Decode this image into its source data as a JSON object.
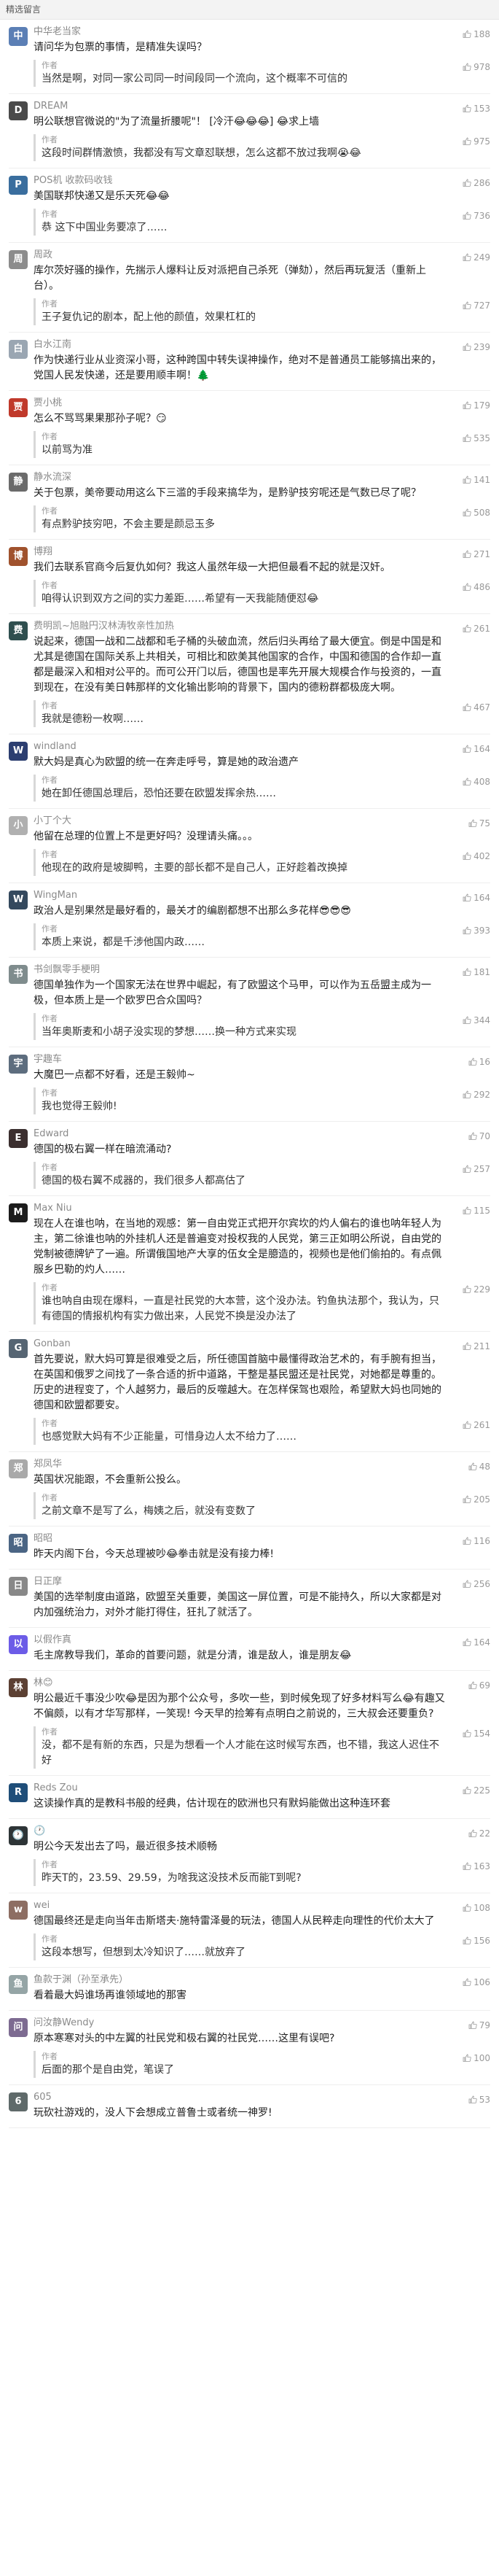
{
  "header": {
    "title": "精选留言"
  },
  "author_tag": "作者",
  "comments": [
    {
      "avatar_color": "#5b7fb5",
      "avatar_char": "中",
      "name": "中华老当家",
      "likes": "188",
      "text": "请问华为包票的事情，是精准失误吗？",
      "reply": "当然是啊，对同一家公司同一时间段同一个流向，这个概率不可信的",
      "reply_likes": "978"
    },
    {
      "avatar_color": "#4a4a4a",
      "avatar_char": "D",
      "name": "DREAM",
      "likes": "153",
      "text": "明公联想官微说的\"为了流量折腰呢\"！ [冷汗😂😂😂] 😂求上墙",
      "reply": "这段时间群情激愤，我都没有写文章怼联想，怎么这都不放过我啊😭😂",
      "reply_likes": "975"
    },
    {
      "avatar_color": "#3a6e9e",
      "avatar_char": "P",
      "name": "POS机 收款码收钱",
      "likes": "286",
      "text": "美国联邦快递又是乐天死😂😂",
      "reply": "恭 这下中国业务要凉了……",
      "reply_likes": "736"
    },
    {
      "avatar_color": "#8c8c8c",
      "avatar_char": "周",
      "name": "周政",
      "likes": "249",
      "text": "库尔茨好骚的操作，先揣示人爆料让反对派把自己杀死（弹劾），然后再玩复活（重新上台）。",
      "reply": "王子复仇记的剧本，配上他的颜值，效果杠杠的",
      "reply_likes": "727"
    },
    {
      "avatar_color": "#9aa6b2",
      "avatar_char": "白",
      "name": "白水江南",
      "likes": "239",
      "text": "作为快递行业从业资深小哥，这种跨国中转失误神操作，绝对不是普通员工能够搞出来的，党国人民发快递，还是要用顺丰啊！🌲",
      "reply": "",
      "reply_likes": ""
    },
    {
      "avatar_color": "#c0392b",
      "avatar_char": "贾",
      "name": "贾小桃",
      "likes": "179",
      "text": "怎么不骂骂果果那孙子呢？😏",
      "reply": "以前骂为准",
      "reply_likes": "535"
    },
    {
      "avatar_color": "#6b6b6b",
      "avatar_char": "静",
      "name": "静水流深",
      "likes": "141",
      "text": "关于包票，美帝要动用这么下三滥的手段来搞华为，是黔驴技穷呢还是气数已尽了呢？",
      "reply": "有点黔驴技穷吧，不会主要是颜忌玉多",
      "reply_likes": "508"
    },
    {
      "avatar_color": "#a0522d",
      "avatar_char": "博",
      "name": "博翔",
      "likes": "271",
      "text": "我们去联系官商今后复仇如何？我这人虽然年级一大把但最看不起的就是汉奸。",
      "reply": "咱得认识到双方之间的实力差距……希望有一天我能随便怼😂",
      "reply_likes": "486"
    },
    {
      "avatar_color": "#2f4f4f",
      "avatar_char": "费",
      "name": "费明凯~旭融円汉林涛牧亲性加热",
      "likes": "261",
      "text": "说起来，德国一战和二战都和毛子桶的头破血流，然后归头再给了最大便宜。倒是中国是和尤其是德国在国际关系上共相关，可相比和欧美其他国家的合作，中国和德国的合作却一直都是最深入和相对公平的。而可公开门以后，德国也是率先开展大规模合作与投资的，一直到现在，在没有美日韩那样的文化输出影响的背景下，国内的德粉群都极庞大啊。",
      "reply": "我就是德粉一枚啊……",
      "reply_likes": "467"
    },
    {
      "avatar_color": "#2c3e70",
      "avatar_char": "W",
      "name": "windland",
      "likes": "164",
      "text": "默大妈是真心为欧盟的统一在奔走呼号，算是她的政治遗产",
      "reply": "她在卸任德国总理后，恐怕还要在欧盟发挥余热……",
      "reply_likes": "408"
    },
    {
      "avatar_color": "#b0b0b0",
      "avatar_char": "小",
      "name": "小丁个大",
      "likes": "75",
      "text": "他留在总理的位置上不是更好吗？没理请头痛。。。",
      "reply": "他现在的政府是坡脚鸭，主要的部长都不是自己人，正好趁着改换掉",
      "reply_likes": "402"
    },
    {
      "avatar_color": "#34495e",
      "avatar_char": "W",
      "name": "WingMan",
      "likes": "164",
      "text": "政治人是别果然是最好看的，最关才的编剧都想不出那么多花样😎😎😎",
      "reply": "本质上来说，都是千涉他国内政……",
      "reply_likes": "393"
    },
    {
      "avatar_color": "#7f8c8d",
      "avatar_char": "书",
      "name": "书剑飘零手梗明",
      "likes": "181",
      "text": "德国单独作为一个国家无法在世界中崛起，有了欧盟这个马甲，可以作为五岳盟主成为一极，但本质上是一个欧罗巴合众国吗？",
      "reply": "当年奥斯麦和小胡子没实现的梦想……换一种方式来实现",
      "reply_likes": "344"
    },
    {
      "avatar_color": "#5d6d7e",
      "avatar_char": "宇",
      "name": "宇趣车",
      "likes": "16",
      "text": "大魔巴一点都不好看，还是王毅帅~",
      "reply": "我也觉得王毅帅!",
      "reply_likes": "292"
    },
    {
      "avatar_color": "#3b2f2f",
      "avatar_char": "E",
      "name": "Edward",
      "likes": "70",
      "text": "德国的极右翼一样在暗流涌动?",
      "reply": "德国的极右翼不成器的，我们很多人都高估了",
      "reply_likes": "257"
    },
    {
      "avatar_color": "#1c1c1c",
      "avatar_char": "M",
      "name": "Max Niu",
      "likes": "115",
      "text": "现在人在谁也呐，在当地的观感：第一自由党正式把开尔宾坎的灼人偏右的谁也呐年轻人为主，第二徐谁也呐的外挂机人还是普遍变对投权我的人民党，第三正如明公所说，自由党的党制被德牌铲了一遍。所谓俄国地产大享的伍女全是臆造的，视频也是他们偷拍的。有点佩服乡巴勒的灼人……",
      "reply": "谁也呐自由现在爆料，一直是社民党的大本营，这个没办法。钓鱼执法那个，我认为，只有德国的情报机构有实力做出来，人民党不换是没办法了",
      "reply_likes": "229"
    },
    {
      "avatar_color": "#566573",
      "avatar_char": "G",
      "name": "Gonban",
      "likes": "211",
      "text": "首先要说，默大妈可算是很难受之后，所任德国首脑中最懂得政治艺术的，有手腕有担当，在英国和俄罗之间找了一条合适的折中道路，干整是基民盟还是社民党，对她都是尊重的。历史的进程变了，个人越努力，最后的反噬越大。在怎样保驾也艰险，希望默大妈也同她的德国和欧盟都要安。",
      "reply": "也感觉默大妈有不少正能量，可惜身边人太不给力了……",
      "reply_likes": "261"
    },
    {
      "avatar_color": "#a9a9a9",
      "avatar_char": "郑",
      "name": "郑凤华",
      "likes": "48",
      "text": "英国状况能跟，不会重新公投么。",
      "reply": "之前文章不是写了么，梅姨之后，就没有变数了",
      "reply_likes": "205"
    },
    {
      "avatar_color": "#4b6584",
      "avatar_char": "昭",
      "name": "昭昭",
      "likes": "116",
      "text": "昨天内阁下台，今天总理被吵😂拳击就是没有接力棒!",
      "reply": "",
      "reply_likes": ""
    },
    {
      "avatar_color": "#888888",
      "avatar_char": "日",
      "name": "日正摩",
      "likes": "256",
      "text": "美国的选举制度由道路，欧盟至关重要，美国这一屏位置，可是不能持久，所以大家都是对内加强统治力，对外才能打得住，狂扎了就活了。",
      "reply": "",
      "reply_likes": ""
    },
    {
      "avatar_color": "#6c5ce7",
      "avatar_char": "以",
      "name": "以假作真",
      "likes": "164",
      "text": "毛主席教导我们，革命的首要问题，就是分清，谁是敌人，谁是朋友😂",
      "reply": "",
      "reply_likes": ""
    },
    {
      "avatar_color": "#5c4033",
      "avatar_char": "林",
      "name": "林😊",
      "likes": "69",
      "text": "明公最近千事没少吹😂是因为那个公众号，多吹一些，到时候免现了好多材料写么😂有趣又不偏颇，以有才华写那样，一笑现! 今天早的捡筹有点明白之前说的，三大叔会还要重负?",
      "reply": "没，都不是有新的东西，只是为想看一个人才能在这时候写东西，也不错，我这人迟住不好",
      "reply_likes": "154"
    },
    {
      "avatar_color": "#1f4e79",
      "avatar_char": "R",
      "name": "Reds Zou",
      "likes": "225",
      "text": "这读操作真的是教科书般的经典，估计现在的欧洲也只有默妈能做出这种连环套",
      "reply": "",
      "reply_likes": ""
    },
    {
      "avatar_color": "#2d3436",
      "avatar_char": "🕐",
      "name": "🕐",
      "likes": "22",
      "text": "明公今天发出去了吗，最近很多技术顺畅",
      "reply": "昨天T的，23.59、29.59，为啥我这没技术反而能T到呢?",
      "reply_likes": "163"
    },
    {
      "avatar_color": "#8d6e63",
      "avatar_char": "w",
      "name": "wei",
      "likes": "108",
      "text": "德国最终还是走向当年击斯塔夫·施特雷泽曼的玩法，德国人从民粹走向理性的代价太大了",
      "reply": "这段本想写，但想到太冷知识了……就放弃了",
      "reply_likes": "156"
    },
    {
      "avatar_color": "#95a5a6",
      "avatar_char": "鱼",
      "name": "鱼款于渊（孙至承先）",
      "likes": "106",
      "text": "看着最大妈谁场再谁领域地的那害",
      "reply": "",
      "reply_likes": ""
    },
    {
      "avatar_color": "#7d6b91",
      "avatar_char": "问",
      "name": "问汝静Wendy",
      "likes": "79",
      "text": "原本寒寒对头的中左翼的社民党和极右翼的社民党……这里有误吧?",
      "reply": "后面的那个是自由党，笔误了",
      "reply_likes": "100"
    },
    {
      "avatar_color": "#5f6a6a",
      "avatar_char": "6",
      "name": "605",
      "likes": "53",
      "text": "玩砍社游戏的，没人下会想成立普鲁士或者统一神罗!",
      "reply": "",
      "reply_likes": ""
    }
  ]
}
